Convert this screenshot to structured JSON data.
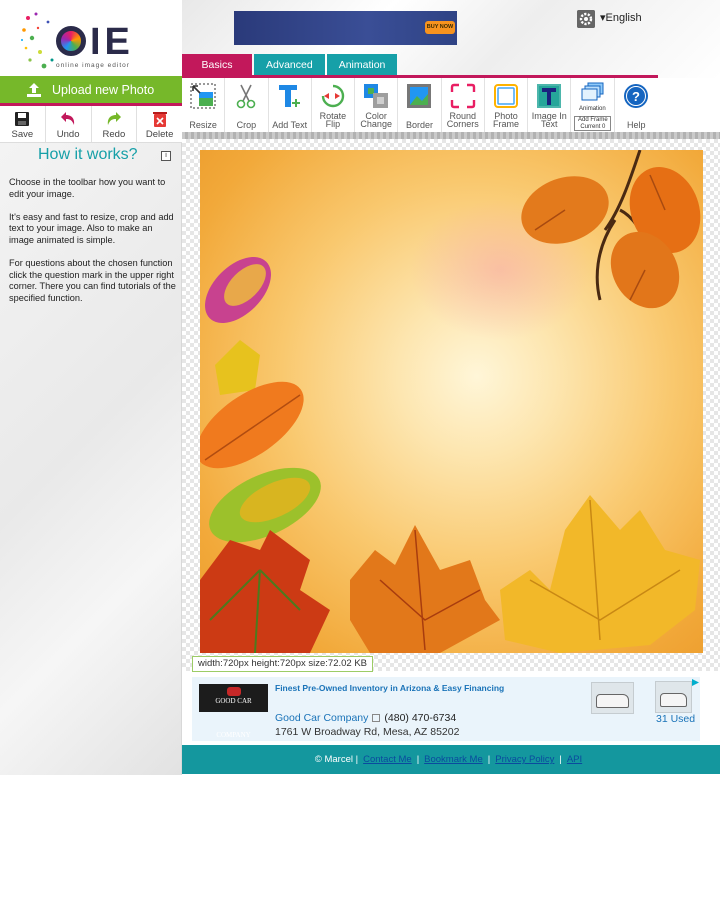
{
  "logo": {
    "text": "OIE",
    "tagline": "online image editor"
  },
  "left": {
    "upload_label": "Upload new Photo",
    "actions": [
      {
        "label": "Save",
        "icon": "save-icon"
      },
      {
        "label": "Undo",
        "icon": "undo-icon"
      },
      {
        "label": "Redo",
        "icon": "redo-icon"
      },
      {
        "label": "Delete",
        "icon": "delete-icon"
      }
    ],
    "how_title": "How it works?",
    "how_paragraphs": [
      "Choose in the toolbar how you want to edit your image.",
      "It's easy and fast to resize, crop and add text to your image. Also to make an image animated is simple.",
      "For questions about the chosen function click the question mark in the upper right corner. There you can find tutorials of the specified function."
    ]
  },
  "header": {
    "ad_button": "BUY NOW",
    "language": "▾English"
  },
  "tabs": [
    {
      "label": "Basics",
      "active": true
    },
    {
      "label": "Advanced",
      "active": false
    },
    {
      "label": "Animation",
      "active": false
    }
  ],
  "toolbar": {
    "tools": [
      {
        "label": "Resize",
        "icon": "resize-icon"
      },
      {
        "label": "Crop",
        "icon": "scissors-icon"
      },
      {
        "label": "Add Text",
        "icon": "text-icon"
      },
      {
        "label": "Rotate\nFlip",
        "icon": "rotate-icon"
      },
      {
        "label": "Color\nChange",
        "icon": "color-change-icon"
      },
      {
        "label": "Border",
        "icon": "border-icon"
      },
      {
        "label": "Round\nCorners",
        "icon": "round-corners-icon"
      },
      {
        "label": "Photo\nFrame",
        "icon": "photo-frame-icon"
      },
      {
        "label": "Image In\nText",
        "icon": "image-in-text-icon"
      },
      {
        "label": "Animation",
        "icon": "animation-icon"
      },
      {
        "label": "Help",
        "icon": "help-icon"
      }
    ],
    "animation_sub": [
      "Add Frame",
      "Current 0"
    ]
  },
  "image_info": "width:720px  height:720px  size:72.02 KB",
  "ad": {
    "logo_text": "GOOD CAR COMPANY",
    "headline": "Finest Pre-Owned Inventory in Arizona & Easy Financing",
    "company": "Good Car Company",
    "phone": "(480) 470-6734",
    "address": "1761 W Broadway Rd, Mesa, AZ 85202",
    "used": "31 Used"
  },
  "footer": {
    "copyright": "© Marcel",
    "links": [
      "Contact Me",
      "Bookmark Me",
      "Privacy Policy",
      "API"
    ]
  },
  "colors": {
    "accent_magenta": "#c2185b",
    "accent_teal": "#16a0a8",
    "upload_green": "#76b82a",
    "footer_teal": "#14979e"
  }
}
